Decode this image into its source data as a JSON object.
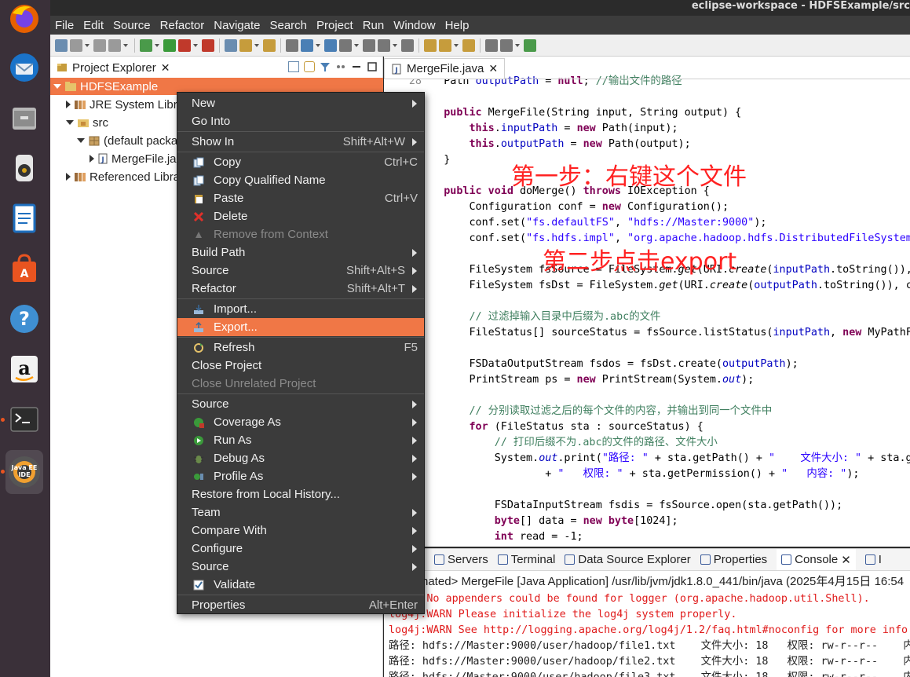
{
  "window": {
    "title": "eclipse-workspace - HDFSExample/src"
  },
  "dock": {
    "items": [
      "firefox-icon",
      "thunderbird-icon",
      "files-icon",
      "rhythmbox-icon",
      "writer-icon",
      "software-icon",
      "help-icon",
      "amazon-icon",
      "terminal-icon"
    ],
    "ide_label": "Java EE IDE"
  },
  "menubar": [
    "File",
    "Edit",
    "Source",
    "Refactor",
    "Navigate",
    "Search",
    "Project",
    "Run",
    "Window",
    "Help"
  ],
  "explorer": {
    "tab": "Project Explorer",
    "tree": [
      {
        "label": "HDFSExample"
      },
      {
        "label": "JRE System Libra"
      },
      {
        "label": "src"
      },
      {
        "label": "(default packa"
      },
      {
        "label": "MergeFile.ja"
      },
      {
        "label": "Referenced Libra"
      }
    ]
  },
  "editor": {
    "tab": "MergeFile.java",
    "lines": [
      {
        "n": "28",
        "parts": [
          [
            "",
            "    Path "
          ],
          [
            "fld",
            "outputPath"
          ],
          [
            "",
            " = "
          ],
          [
            "kw",
            "null"
          ],
          [
            "",
            "; "
          ],
          [
            "cmt",
            "//输出文件的路径"
          ]
        ]
      },
      {
        "n": "29",
        "parts": [
          [
            "",
            ""
          ]
        ]
      },
      {
        "n": "",
        "parts": [
          [
            "kw",
            "    public"
          ],
          [
            "",
            " MergeFile(String input, String output) {"
          ]
        ]
      },
      {
        "n": "",
        "parts": [
          [
            "kw",
            "        this"
          ],
          [
            "",
            "."
          ],
          [
            "fld",
            "inputPath"
          ],
          [
            "",
            " = "
          ],
          [
            "kw",
            "new"
          ],
          [
            "",
            " Path(input);"
          ]
        ]
      },
      {
        "n": "",
        "parts": [
          [
            "kw",
            "        this"
          ],
          [
            "",
            "."
          ],
          [
            "fld",
            "outputPath"
          ],
          [
            "",
            " = "
          ],
          [
            "kw",
            "new"
          ],
          [
            "",
            " Path(output);"
          ]
        ]
      },
      {
        "n": "",
        "parts": [
          [
            "",
            "    }"
          ]
        ]
      },
      {
        "n": "",
        "parts": [
          [
            "",
            ""
          ]
        ]
      },
      {
        "n": "",
        "parts": [
          [
            "kw",
            "    public void"
          ],
          [
            "",
            " doMerge() "
          ],
          [
            "kw",
            "throws"
          ],
          [
            "",
            " IOException {"
          ]
        ]
      },
      {
        "n": "",
        "parts": [
          [
            "",
            "        Configuration conf = "
          ],
          [
            "kw",
            "new"
          ],
          [
            "",
            " Configuration();"
          ]
        ]
      },
      {
        "n": "",
        "parts": [
          [
            "",
            "        conf.set("
          ],
          [
            "str",
            "\"fs.defaultFS\""
          ],
          [
            "",
            ", "
          ],
          [
            "str",
            "\"hdfs://Master:9000\""
          ],
          [
            "",
            ");"
          ]
        ]
      },
      {
        "n": "",
        "parts": [
          [
            "",
            "        conf.set("
          ],
          [
            "str",
            "\"fs.hdfs.impl\""
          ],
          [
            "",
            ", "
          ],
          [
            "str",
            "\"org.apache.hadoop.hdfs.DistributedFileSystem"
          ]
        ]
      },
      {
        "n": "",
        "parts": [
          [
            "",
            ""
          ]
        ]
      },
      {
        "n": "",
        "parts": [
          [
            "",
            "        FileSystem fsSource = FileSystem."
          ],
          [
            "it",
            "get"
          ],
          [
            "",
            "(URI."
          ],
          [
            "it",
            "create"
          ],
          [
            "",
            "("
          ],
          [
            "fld",
            "inputPath"
          ],
          [
            "",
            ".toString()),"
          ]
        ]
      },
      {
        "n": "",
        "parts": [
          [
            "",
            "        FileSystem fsDst = FileSystem."
          ],
          [
            "it",
            "get"
          ],
          [
            "",
            "(URI."
          ],
          [
            "it",
            "create"
          ],
          [
            "",
            "("
          ],
          [
            "fld",
            "outputPath"
          ],
          [
            "",
            ".toString()), co"
          ]
        ]
      },
      {
        "n": "",
        "parts": [
          [
            "",
            ""
          ]
        ]
      },
      {
        "n": "",
        "parts": [
          [
            "cmt",
            "        // 过滤掉输入目录中后缀为.abc的文件"
          ]
        ]
      },
      {
        "n": "",
        "parts": [
          [
            "",
            "        FileStatus[] sourceStatus = fsSource.listStatus("
          ],
          [
            "fld",
            "inputPath"
          ],
          [
            "",
            ", "
          ],
          [
            "kw",
            "new"
          ],
          [
            "",
            " MyPathFi"
          ]
        ]
      },
      {
        "n": "",
        "parts": [
          [
            "",
            ""
          ]
        ]
      },
      {
        "n": "",
        "parts": [
          [
            "",
            "        FSDataOutputStream fsdos = fsDst.create("
          ],
          [
            "fld",
            "outputPath"
          ],
          [
            "",
            ");"
          ]
        ]
      },
      {
        "n": "",
        "parts": [
          [
            "",
            "        PrintStream ps = "
          ],
          [
            "kw",
            "new"
          ],
          [
            "",
            " PrintStream(System."
          ],
          [
            "fld it",
            "out"
          ],
          [
            "",
            ");"
          ]
        ]
      },
      {
        "n": "",
        "parts": [
          [
            "",
            ""
          ]
        ]
      },
      {
        "n": "",
        "parts": [
          [
            "cmt",
            "        // 分别读取过滤之后的每个文件的内容，并输出到同一个文件中"
          ]
        ]
      },
      {
        "n": "",
        "parts": [
          [
            "kw",
            "        for"
          ],
          [
            "",
            " (FileStatus sta : sourceStatus) {"
          ]
        ]
      },
      {
        "n": "",
        "parts": [
          [
            "cmt",
            "            // 打印后缀不为.abc的文件的路径、文件大小"
          ]
        ]
      },
      {
        "n": "",
        "parts": [
          [
            "",
            "            System."
          ],
          [
            "fld it",
            "out"
          ],
          [
            "",
            ".print("
          ],
          [
            "str",
            "\"路径: \""
          ],
          [
            "",
            " + sta.getPath() + "
          ],
          [
            "str",
            "\"    文件大小: \""
          ],
          [
            "",
            " + sta.get"
          ]
        ]
      },
      {
        "n": "",
        "parts": [
          [
            "",
            "                    + "
          ],
          [
            "str",
            "\"   权限: \""
          ],
          [
            "",
            " + sta.getPermission() + "
          ],
          [
            "str",
            "\"   内容: \""
          ],
          [
            "",
            ");"
          ]
        ]
      },
      {
        "n": "",
        "parts": [
          [
            "",
            ""
          ]
        ]
      },
      {
        "n": "",
        "parts": [
          [
            "",
            "            FSDataInputStream fsdis = fsSource.open(sta.getPath());"
          ]
        ]
      },
      {
        "n": "",
        "parts": [
          [
            "kw",
            "            byte"
          ],
          [
            "",
            "[] data = "
          ],
          [
            "kw",
            "new byte"
          ],
          [
            "",
            "[1024];"
          ]
        ]
      },
      {
        "n": "",
        "parts": [
          [
            "kw",
            "            int"
          ],
          [
            "",
            " read = -1;"
          ]
        ]
      }
    ]
  },
  "annotations": {
    "step1": "第一步：右键这个文件",
    "step2": "第二步点击export"
  },
  "context_menu": {
    "items": [
      {
        "label": "New",
        "shortcut": "",
        "submenu": true,
        "icon": ""
      },
      {
        "label": "Go Into",
        "shortcut": "",
        "submenu": false,
        "icon": ""
      },
      {
        "sep": true
      },
      {
        "label": "Show In",
        "shortcut": "Shift+Alt+W",
        "submenu": true,
        "icon": ""
      },
      {
        "sep": true
      },
      {
        "label": "Copy",
        "shortcut": "Ctrl+C",
        "submenu": false,
        "icon": "copy-icon"
      },
      {
        "label": "Copy Qualified Name",
        "shortcut": "",
        "submenu": false,
        "icon": "copy-qualified-icon"
      },
      {
        "label": "Paste",
        "shortcut": "Ctrl+V",
        "submenu": false,
        "icon": "paste-icon"
      },
      {
        "label": "Delete",
        "shortcut": "",
        "submenu": false,
        "icon": "delete-icon"
      },
      {
        "label": "Remove from Context",
        "shortcut": "",
        "submenu": false,
        "icon": "remove-context-icon",
        "disabled": true
      },
      {
        "label": "Build Path",
        "shortcut": "",
        "submenu": true,
        "icon": ""
      },
      {
        "label": "Source",
        "shortcut": "Shift+Alt+S",
        "submenu": true,
        "icon": ""
      },
      {
        "label": "Refactor",
        "shortcut": "Shift+Alt+T",
        "submenu": true,
        "icon": ""
      },
      {
        "sep": true
      },
      {
        "label": "Import...",
        "shortcut": "",
        "submenu": false,
        "icon": "import-icon"
      },
      {
        "label": "Export...",
        "shortcut": "",
        "submenu": false,
        "icon": "export-icon",
        "highlighted": true
      },
      {
        "sep": true
      },
      {
        "label": "Refresh",
        "shortcut": "F5",
        "submenu": false,
        "icon": "refresh-icon"
      },
      {
        "label": "Close Project",
        "shortcut": "",
        "submenu": false,
        "icon": ""
      },
      {
        "label": "Close Unrelated Project",
        "shortcut": "",
        "submenu": false,
        "icon": "",
        "disabled": true
      },
      {
        "sep": true
      },
      {
        "label": "Source",
        "shortcut": "",
        "submenu": true,
        "icon": ""
      },
      {
        "label": "Coverage As",
        "shortcut": "",
        "submenu": true,
        "icon": "coverage-icon"
      },
      {
        "label": "Run As",
        "shortcut": "",
        "submenu": true,
        "icon": "run-icon"
      },
      {
        "label": "Debug As",
        "shortcut": "",
        "submenu": true,
        "icon": "debug-icon"
      },
      {
        "label": "Profile As",
        "shortcut": "",
        "submenu": true,
        "icon": "profile-icon"
      },
      {
        "label": "Restore from Local History...",
        "shortcut": "",
        "submenu": false,
        "icon": ""
      },
      {
        "label": "Team",
        "shortcut": "",
        "submenu": true,
        "icon": ""
      },
      {
        "label": "Compare With",
        "shortcut": "",
        "submenu": true,
        "icon": ""
      },
      {
        "label": "Configure",
        "shortcut": "",
        "submenu": true,
        "icon": ""
      },
      {
        "label": "Source",
        "shortcut": "",
        "submenu": true,
        "icon": ""
      },
      {
        "label": "Validate",
        "shortcut": "",
        "submenu": false,
        "icon": "validate-icon"
      },
      {
        "sep": true
      },
      {
        "label": "Properties",
        "shortcut": "Alt+Enter",
        "submenu": false,
        "icon": ""
      }
    ]
  },
  "bottom_panel": {
    "tabs": [
      "blems",
      "Servers",
      "Terminal",
      "Data Source Explorer",
      "Properties",
      "Console",
      "I"
    ],
    "active_tab": "Console",
    "info": "nated> MergeFile [Java Application] /usr/lib/jvm/jdk1.8.0_441/bin/java  (2025年4月15日 16:54",
    "console_lines": [
      {
        "text": ":WARN No appenders could be found for logger (org.apache.hadoop.util.Shell).",
        "err": true
      },
      {
        "text": "log4j:WARN Please initialize the log4j system properly.",
        "err": true
      },
      {
        "text": "log4j:WARN See http://logging.apache.org/log4j/1.2/faq.html#noconfig for more info.",
        "err": true
      },
      {
        "text": "路径: hdfs://Master:9000/user/hadoop/file1.txt    文件大小: 18   权限: rw-r--r--    内容:",
        "err": false
      },
      {
        "text": "路径: hdfs://Master:9000/user/hadoop/file2.txt    文件大小: 18   权限: rw-r--r--    内容:",
        "err": false
      },
      {
        "text": "路径: hdfs://Master:9000/user/hadoop/file3.txt    文件大小: 18   权限: rw-r--r--    内容:",
        "err": false
      }
    ]
  },
  "colors": {
    "accent": "#f07746",
    "menu_bg": "#3b3b3b",
    "dock_bg": "#3a3039",
    "annotation": "#ff2222"
  }
}
